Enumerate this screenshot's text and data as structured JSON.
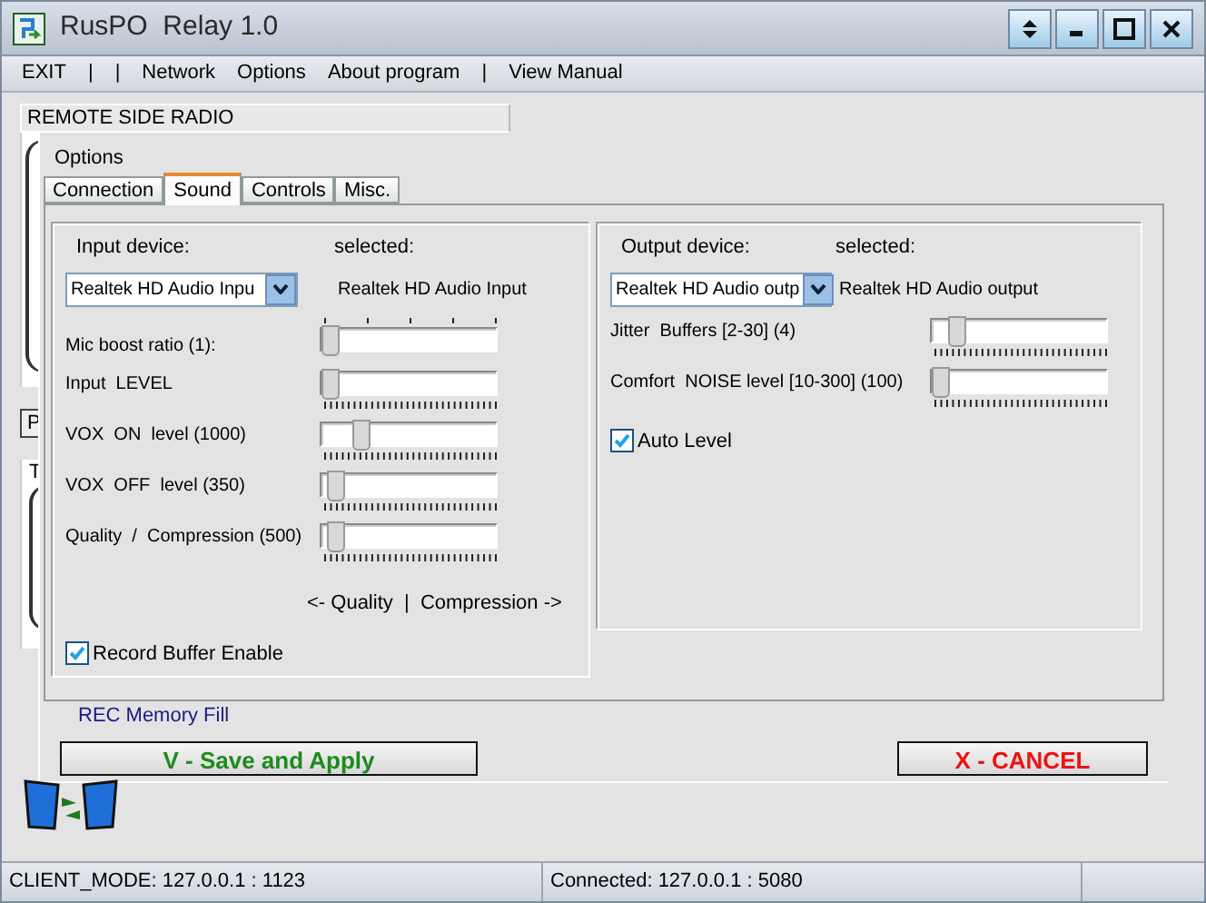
{
  "window": {
    "title": "RusPO  Relay 1.0"
  },
  "menu": [
    {
      "kind": "item",
      "label": "EXIT"
    },
    {
      "kind": "separator",
      "label": "|"
    },
    {
      "kind": "separator",
      "label": "|"
    },
    {
      "kind": "item",
      "label": "Network"
    },
    {
      "kind": "item",
      "label": "Options"
    },
    {
      "kind": "item",
      "label": "About program"
    },
    {
      "kind": "separator",
      "label": "|"
    },
    {
      "kind": "item",
      "label": "View Manual"
    }
  ],
  "remote_panel": {
    "title": "REMOTE SIDE RADIO",
    "fragments": [
      "P",
      "T"
    ]
  },
  "dialog": {
    "title": "Options",
    "tabs": [
      {
        "label": "Connection",
        "selected": false
      },
      {
        "label": "Sound",
        "selected": true
      },
      {
        "label": "Controls",
        "selected": false
      },
      {
        "label": "Misc.",
        "selected": false
      }
    ],
    "input": {
      "device_label": "Input device:",
      "selected_label": "selected:",
      "device_value": "Realtek HD Audio Inpu",
      "selected_value": "Realtek HD Audio Input",
      "sliders": [
        {
          "label": "Mic boost ratio (1):",
          "level": 0,
          "kind": "toptick"
        },
        {
          "label": "Input  LEVEL",
          "level": 0,
          "kind": "bottomtick"
        },
        {
          "label": "VOX  ON  level (1000)",
          "level": 0.2,
          "kind": "bottomtick"
        },
        {
          "label": "VOX  OFF  level (350)",
          "level": 0.03,
          "kind": "bottomtick"
        },
        {
          "label": "Quality  /  Compression (500)",
          "level": 0.03,
          "kind": "bottomtick"
        }
      ],
      "caption": "<- Quality  |  Compression ->",
      "checkbox": {
        "label": "Record Buffer Enable",
        "checked": true
      }
    },
    "output": {
      "device_label": "Output device:",
      "selected_label": "selected:",
      "device_value": "Realtek HD Audio outp",
      "selected_value": "Realtek HD Audio output",
      "sliders": [
        {
          "label": "Jitter  Buffers [2-30] (4)",
          "level": 0.1,
          "kind": "bottomtick"
        },
        {
          "label": "Comfort  NOISE level [10-300] (100)",
          "level": 0,
          "kind": "bottomtick"
        }
      ],
      "checkbox": {
        "label": "Auto Level",
        "checked": true
      }
    },
    "rec_label": "REC Memory Fill",
    "buttons": [
      {
        "kind": "apply",
        "label": "V - Save and Apply"
      },
      {
        "kind": "cancel",
        "label": "X - CANCEL"
      }
    ]
  },
  "status_bar": [
    "CLIENT_MODE: 127.0.0.1 : 1123",
    "Connected: 127.0.0.1 : 5080"
  ]
}
